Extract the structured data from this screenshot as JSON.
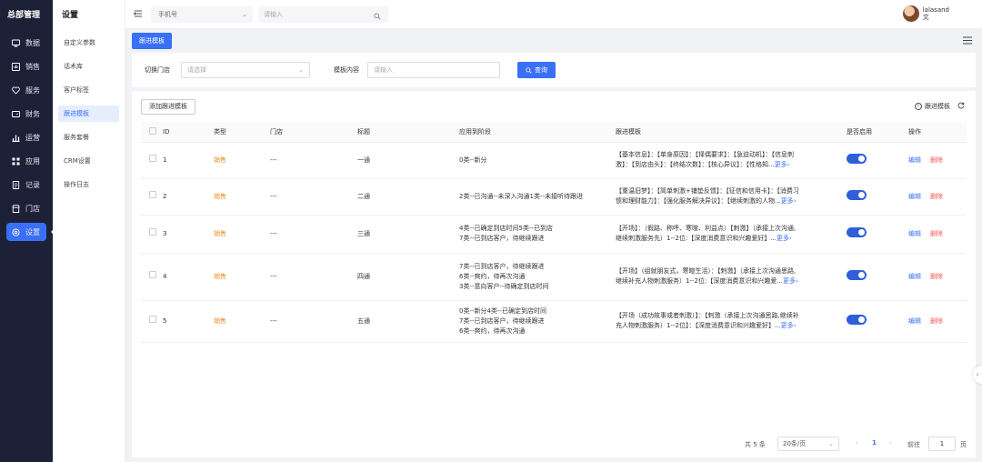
{
  "nav": {
    "title": "总部管理",
    "items": [
      {
        "label": "数据",
        "icon": "monitor-icon"
      },
      {
        "label": "销售",
        "icon": "grid-chart-icon"
      },
      {
        "label": "服务",
        "icon": "heart-icon"
      },
      {
        "label": "财务",
        "icon": "wallet-icon"
      },
      {
        "label": "运营",
        "icon": "bar-chart-icon"
      },
      {
        "label": "应用",
        "icon": "apps-icon"
      },
      {
        "label": "记录",
        "icon": "document-icon"
      },
      {
        "label": "门店",
        "icon": "store-icon"
      },
      {
        "label": "设置",
        "icon": "settings-icon"
      }
    ],
    "active_index": 8,
    "accent": "#3a6ff7"
  },
  "subnav": {
    "title": "设置",
    "items": [
      "自定义参数",
      "话术库",
      "客户标签",
      "跟进模板",
      "服务套餐",
      "CRM设置",
      "操作日志"
    ],
    "active_index": 3
  },
  "topbar": {
    "phone_select": "手机号",
    "search_placeholder": "请输入",
    "user_name": "lalasand",
    "user_sub": "文"
  },
  "tabs": {
    "active": "跟进模板"
  },
  "filter": {
    "store_label": "切换门店",
    "store_placeholder": "请选择",
    "content_label": "模板内容",
    "content_placeholder": "请输入",
    "query_label": "查询"
  },
  "table_card": {
    "add_label": "添加跟进模板",
    "help_label": "跟进模板",
    "columns": [
      "ID",
      "类型",
      "门店",
      "标题",
      "应用到阶段",
      "跟进模板",
      "是否启用",
      "操作"
    ],
    "edit_label": "编辑",
    "delete_label": "删除",
    "more_label": "更多",
    "rows": [
      {
        "id": "1",
        "type": "销售",
        "store": "---",
        "title": "一通",
        "stages": [
          "0类--新分"
        ],
        "template_l1": "【基本信息】：【单身原因】：【择偶要求】：【急迫动机】：【信息刺",
        "template_l2": "激】：【到店由头】：【终结次数】：【核心异议】：【性格知...",
        "enabled": true
      },
      {
        "id": "2",
        "type": "销售",
        "store": "---",
        "title": "二通",
        "stages": [
          "2类--已沟通--未深入沟通1类--未接听待跟进"
        ],
        "template_l1": "【重温旧梦】：【简单刺激+铺垫反馈】：【征信和信用卡】：【消费习",
        "template_l2": "惯和理财能力】：【强化服务解决异议】：【继续刺激的人物...",
        "enabled": true
      },
      {
        "id": "3",
        "type": "销售",
        "store": "---",
        "title": "三通",
        "stages": [
          "4类--已确定到店时间5类--已到店",
          "7类--已到店客户，待继续跟进"
        ],
        "template_l1": "【开场】：（假路、称呼、寒暄、利益点）【刺激】（承接上次沟通,",
        "template_l2": "继续刺激服务先）1--2位:【深度消费意识和兴趣爱好】...",
        "enabled": true
      },
      {
        "id": "4",
        "type": "销售",
        "store": "---",
        "title": "四通",
        "stages": [
          "7类--已到店客户，待继续跟进",
          "6类--爽约，待再次沟通",
          "3类--意向客户--待确定到店时间"
        ],
        "template_l1": "【开场】（组就朋友式，寒暄生活）：【刺激】（承接上次沟通思路,",
        "template_l2": "继续补充人物刺激服务）1--2位:【深度消费意识和兴趣爱...",
        "enabled": true
      },
      {
        "id": "5",
        "type": "销售",
        "store": "---",
        "title": "五通",
        "stages": [
          "0类--新分4类--已确定到店时间",
          "7类--已到店客户，待继续跟进",
          "6类--爽约，待再次沟通"
        ],
        "template_l1": "【开场（成功故事或者刺激）】：【刺激（承接上次沟通思路,继续补",
        "template_l2": "充人物刺激服务）1--2位】：【深度消费意识和兴趣爱好】...",
        "enabled": true
      }
    ]
  },
  "pager": {
    "total": "共 5 条",
    "page_size": "20条/页",
    "current": "1",
    "goto_label": "前往",
    "goto_value": "1",
    "page_suffix": "页"
  }
}
